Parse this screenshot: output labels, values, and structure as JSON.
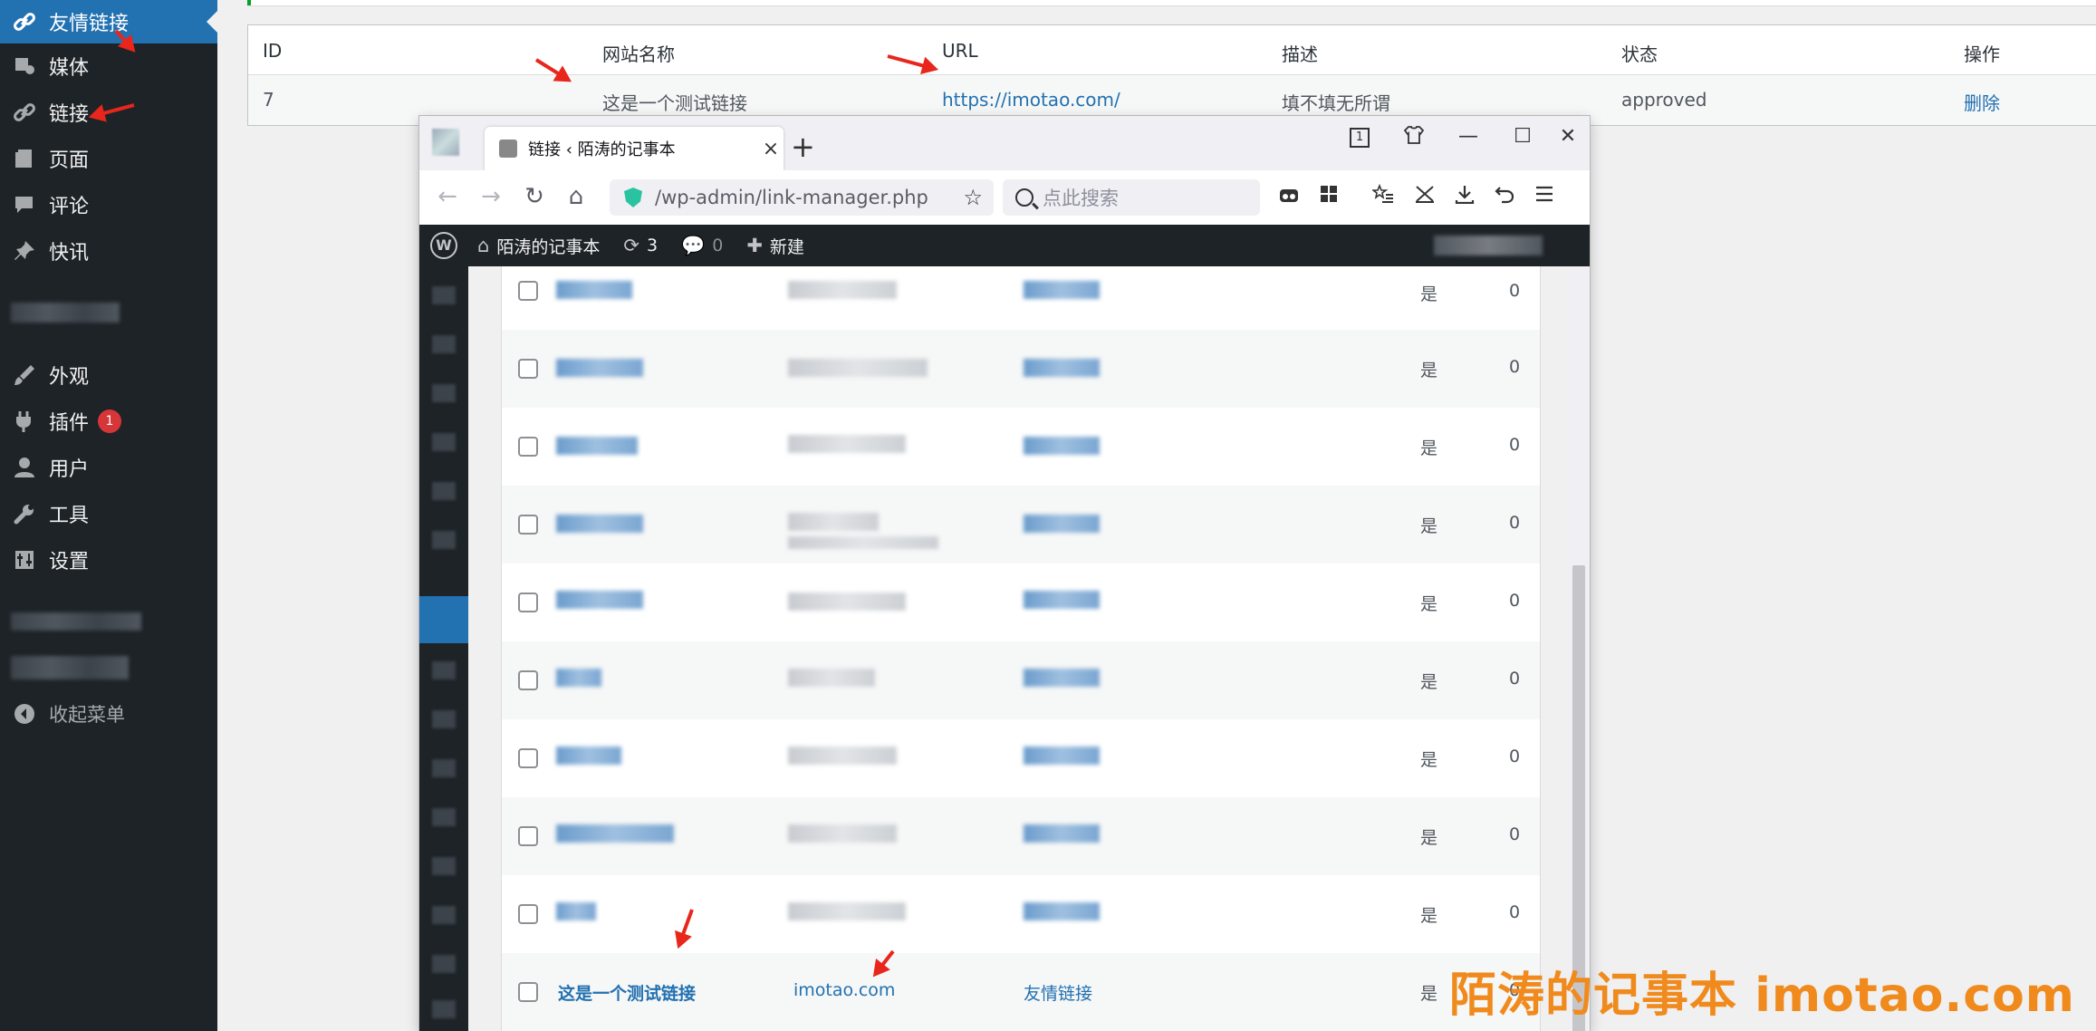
{
  "sidebar": {
    "items": [
      {
        "label": "友情链接",
        "icon": "link-icon"
      },
      {
        "label": "媒体",
        "icon": "media-icon"
      },
      {
        "label": "链接",
        "icon": "link-icon"
      },
      {
        "label": "页面",
        "icon": "page-icon"
      },
      {
        "label": "评论",
        "icon": "comment-icon"
      },
      {
        "label": "快讯",
        "icon": "pin-icon"
      },
      {
        "label": "外观",
        "icon": "brush-icon"
      },
      {
        "label": "插件",
        "icon": "plugin-icon",
        "badge": "1"
      },
      {
        "label": "用户",
        "icon": "user-icon"
      },
      {
        "label": "工具",
        "icon": "wrench-icon"
      },
      {
        "label": "设置",
        "icon": "settings-icon"
      },
      {
        "label": "收起菜单",
        "icon": "collapse-icon"
      }
    ]
  },
  "links_table": {
    "headers": [
      "ID",
      "网站名称",
      "URL",
      "描述",
      "状态",
      "操作"
    ],
    "row": {
      "id": "7",
      "name": "这是一个测试链接",
      "url": "https://imotao.com/",
      "description": "填不填无所谓",
      "status": "approved",
      "action": "删除"
    }
  },
  "browser": {
    "tab_title": "链接 ‹ 陌涛的记事本",
    "tab_close": "×",
    "new_tab": "+",
    "url": "/wp-admin/link-manager.php",
    "search_placeholder": "点此搜索",
    "window_controls": {
      "tab_counter": "1",
      "minimize": "—",
      "maximize": "☐",
      "close": "✕"
    },
    "nav": {
      "back": "←",
      "forward": "→",
      "reload": "↻",
      "home": "⌂",
      "bookmark": "☆"
    }
  },
  "adminbar": {
    "site_name": "陌涛的记事本",
    "updates": "3",
    "comments": "0",
    "new_label": "新建"
  },
  "inner_list": {
    "visible_label": "是",
    "count": "0",
    "last_row": {
      "name": "这是一个测试链接",
      "url": "imotao.com",
      "category": "友情链接",
      "visible": "是",
      "rating": "0"
    }
  },
  "watermark": "陌涛的记事本 imotao.com",
  "colors": {
    "wp_sidebar": "#1d2327",
    "wp_blue": "#2271b1",
    "badge_red": "#d63638",
    "arrow_red": "#e8261c",
    "watermark_orange": "#f08a1c"
  }
}
